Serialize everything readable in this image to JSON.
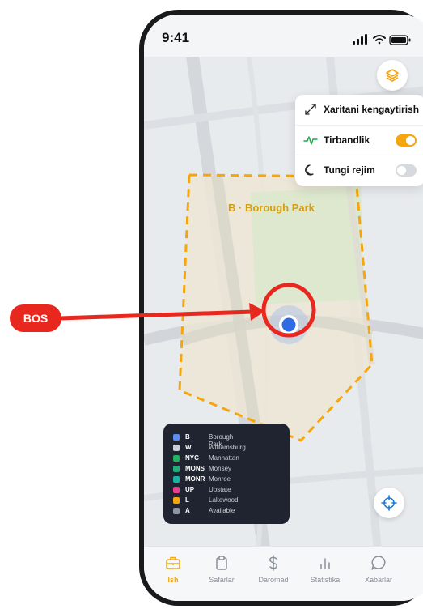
{
  "status_bar": {
    "time": "9:41"
  },
  "map": {
    "zone_label": "B · Borough Park",
    "layers_icon": "layers-icon",
    "locate_icon": "crosshair-icon",
    "zone_color": "#f5a60d",
    "location_dot_color": "#2f6be5"
  },
  "layers_menu": {
    "items": [
      {
        "label": "Xaritani kengaytirish",
        "icon": "expand-icon"
      },
      {
        "label": "Tirbandlik",
        "icon": "traffic-pulse-icon",
        "toggle": "on"
      },
      {
        "label": "Tungi rejim",
        "icon": "moon-icon",
        "toggle": "off"
      }
    ],
    "toggle_on_color": "#f5a60d"
  },
  "legend": {
    "items": [
      {
        "code": "B",
        "name": "Borough Park",
        "color": "#5b8def"
      },
      {
        "code": "W",
        "name": "Williamsburg",
        "color": "#c9cdd4"
      },
      {
        "code": "NYC",
        "name": "Manhattan",
        "color": "#22b35e"
      },
      {
        "code": "MONS",
        "name": "Monsey",
        "color": "#1fae7a"
      },
      {
        "code": "MONR",
        "name": "Monroe",
        "color": "#18b5a6"
      },
      {
        "code": "UP",
        "name": "Upstate",
        "color": "#e3408f"
      },
      {
        "code": "L",
        "name": "Lakewood",
        "color": "#f5a60d"
      },
      {
        "code": "A",
        "name": "Available",
        "color": "#8d96a5"
      }
    ]
  },
  "tabs": [
    {
      "label": "Ish",
      "icon": "briefcase-icon",
      "active": true
    },
    {
      "label": "Safarlar",
      "icon": "clipboard-icon",
      "active": false
    },
    {
      "label": "Daromad",
      "icon": "dollar-icon",
      "active": false
    },
    {
      "label": "Statistika",
      "icon": "bar-chart-icon",
      "active": false
    },
    {
      "label": "Xabarlar",
      "icon": "chat-bubble-icon",
      "active": false
    }
  ],
  "annotation": {
    "label": "BOS",
    "color": "#e8281f"
  }
}
